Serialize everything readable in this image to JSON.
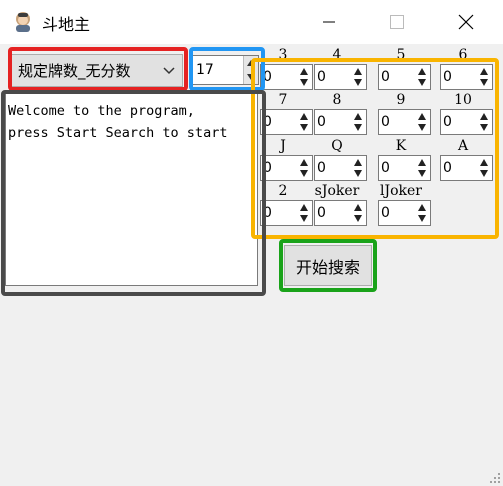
{
  "window": {
    "title": "斗地主",
    "app_icon": "player-avatar-icon"
  },
  "controls": {
    "mode_select": {
      "value": "规定牌数_无分数"
    },
    "card_count": {
      "value": "17"
    },
    "search_button": "开始搜索"
  },
  "log": {
    "text": "Welcome to the program,\npress Start Search to start"
  },
  "cards": [
    {
      "label": "3",
      "value": "0"
    },
    {
      "label": "4",
      "value": "0"
    },
    {
      "label": "5",
      "value": "0"
    },
    {
      "label": "6",
      "value": "0"
    },
    {
      "label": "7",
      "value": "0"
    },
    {
      "label": "8",
      "value": "0"
    },
    {
      "label": "9",
      "value": "0"
    },
    {
      "label": "10",
      "value": "0"
    },
    {
      "label": "J",
      "value": "0"
    },
    {
      "label": "Q",
      "value": "0"
    },
    {
      "label": "K",
      "value": "0"
    },
    {
      "label": "A",
      "value": "0"
    },
    {
      "label": "2",
      "value": "0"
    },
    {
      "label": "sJoker",
      "value": "0"
    },
    {
      "label": "lJoker",
      "value": "0"
    }
  ],
  "highlight_colors": {
    "red": "#e52222",
    "blue": "#2196f3",
    "orange": "#f9b400",
    "gray": "#4a4a4a",
    "green": "#1aa31a"
  }
}
